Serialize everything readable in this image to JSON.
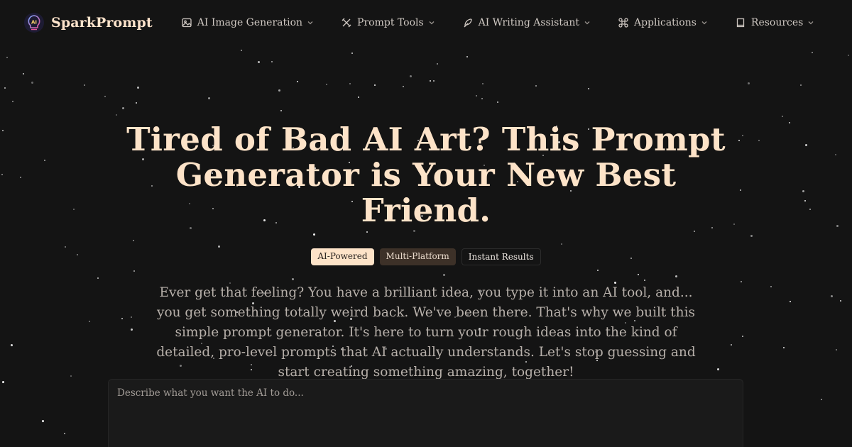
{
  "brand": {
    "name": "SparkPrompt",
    "logo_icon": "ai-lightbulb-icon"
  },
  "nav": {
    "items": [
      {
        "label": "AI Image Generation",
        "icon": "image-icon"
      },
      {
        "label": "Prompt Tools",
        "icon": "tools-icon"
      },
      {
        "label": "AI Writing Assistant",
        "icon": "feather-icon"
      },
      {
        "label": "Applications",
        "icon": "command-icon"
      },
      {
        "label": "Resources",
        "icon": "book-icon"
      }
    ]
  },
  "hero": {
    "title": "Tired of Bad AI Art? This Prompt Generator is Your New Best Friend.",
    "badges": [
      "AI-Powered",
      "Multi-Platform",
      "Instant Results"
    ],
    "description": "Ever get that feeling? You have a brilliant idea, you type it into an AI tool, and... you get something totally weird back. We've been there. That's why we built this simple prompt generator. It's here to turn your rough ideas into the kind of detailed, pro-level prompts that AI actually understands. Let's stop guessing and start creating something amazing, together!"
  },
  "prompt_input": {
    "placeholder": "Describe what you want the AI to do...",
    "value": ""
  },
  "colors": {
    "background": "#141414",
    "accent": "#fde3c8",
    "badge_secondary": "#3d3128"
  }
}
